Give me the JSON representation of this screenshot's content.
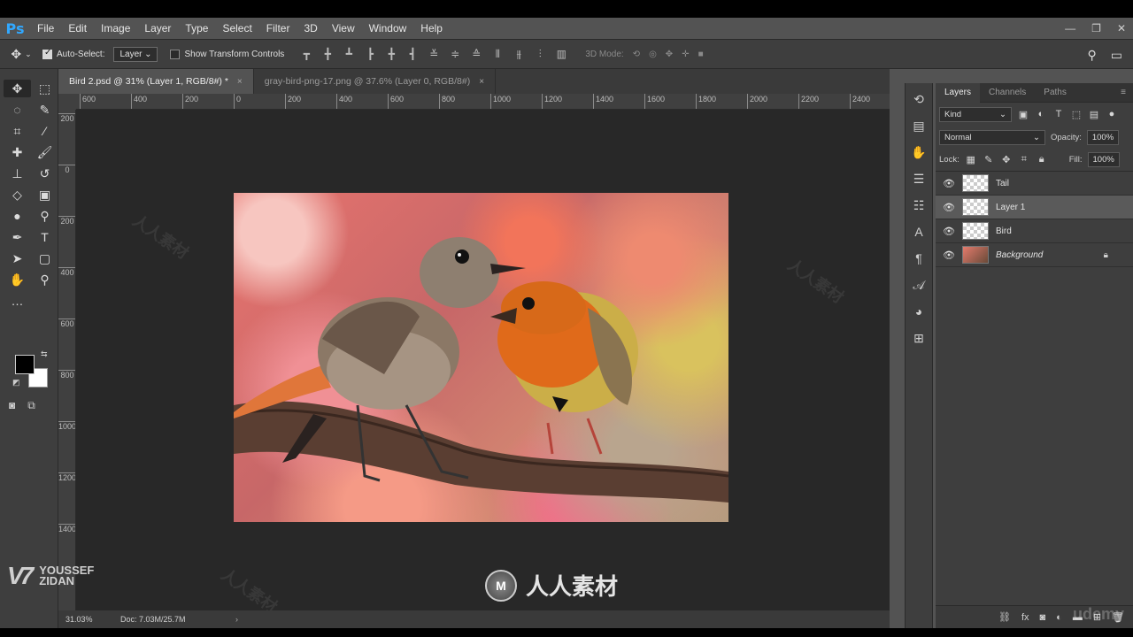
{
  "app": {
    "logo": "Ps"
  },
  "menu": [
    "File",
    "Edit",
    "Image",
    "Layer",
    "Type",
    "Select",
    "Filter",
    "3D",
    "View",
    "Window",
    "Help"
  ],
  "window_controls": [
    "—",
    "❐",
    "✕"
  ],
  "options": {
    "auto_select_label": "Auto-Select:",
    "auto_select_value": "Layer",
    "transform_label": "Show Transform Controls",
    "mode3d_label": "3D Mode:"
  },
  "tabs": [
    {
      "label": "Bird 2.psd @ 31% (Layer 1, RGB/8#) *",
      "close": "×"
    },
    {
      "label": "gray-bird-png-17.png @ 37.6% (Layer 0, RGB/8#)",
      "close": "×"
    }
  ],
  "ruler_h": [
    "600",
    "400",
    "200",
    "0",
    "200",
    "400",
    "600",
    "800",
    "1000",
    "1200",
    "1400",
    "1600",
    "1800",
    "2000",
    "2200",
    "2400"
  ],
  "ruler_v": [
    "200",
    "0",
    "200",
    "400",
    "600",
    "800",
    "1000",
    "1200",
    "1400"
  ],
  "status": {
    "zoom": "31.03%",
    "doc": "Doc: 7.03M/25.7M",
    "arrow": "›"
  },
  "branding": {
    "mark": "V7",
    "name_line1": "YOUSSEF",
    "name_line2": "ZIDAN",
    "site": "人人素材",
    "udemy": "udemy"
  },
  "layers_panel": {
    "tabs": [
      "Layers",
      "Channels",
      "Paths"
    ],
    "menu_icon": "≡",
    "kind_label": "Kind",
    "blend_mode": "Normal",
    "opacity_label": "Opacity:",
    "opacity_value": "100%",
    "lock_label": "Lock:",
    "fill_label": "Fill:",
    "fill_value": "100%",
    "layers": [
      {
        "name": "Tail"
      },
      {
        "name": "Layer 1"
      },
      {
        "name": "Bird"
      },
      {
        "name": "Background"
      }
    ]
  },
  "colors": {
    "accent": "#31a8ff",
    "panel_bg": "#3e3e3e",
    "canvas_bg": "#282828",
    "foreground": "#000000",
    "background": "#ffffff"
  }
}
